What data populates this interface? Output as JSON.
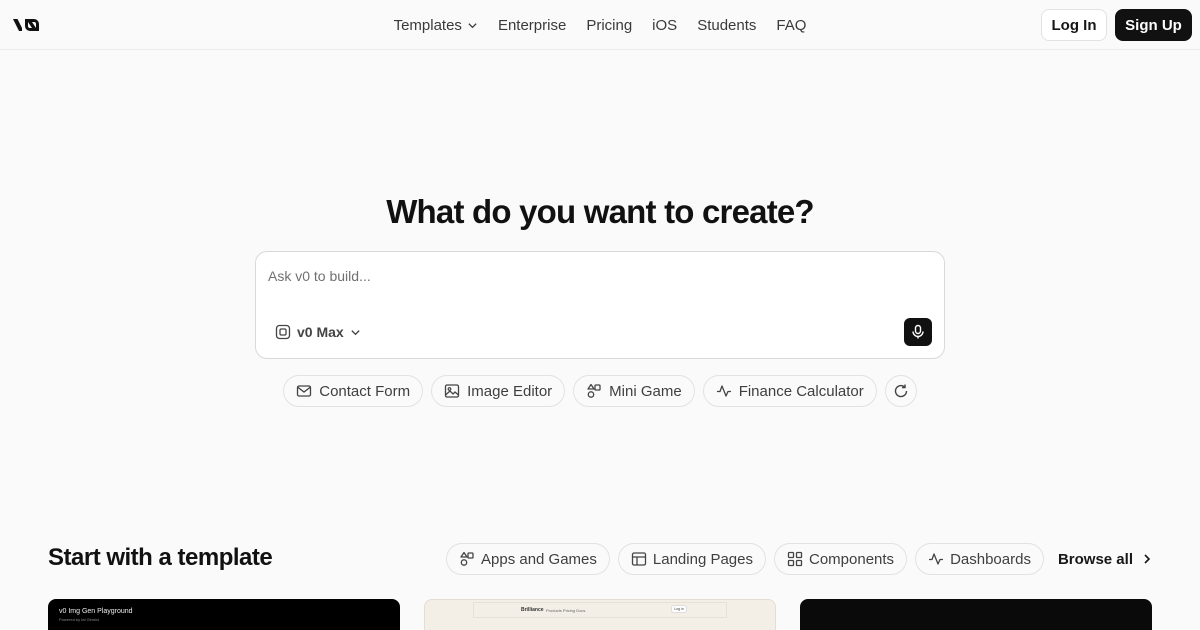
{
  "header": {
    "logo_text": "v0",
    "nav": [
      {
        "label": "Templates",
        "has_dropdown": true
      },
      {
        "label": "Enterprise"
      },
      {
        "label": "Pricing"
      },
      {
        "label": "iOS"
      },
      {
        "label": "Students"
      },
      {
        "label": "FAQ"
      }
    ],
    "login_label": "Log In",
    "signup_label": "Sign Up"
  },
  "hero": {
    "title": "What do you want to create?",
    "prompt": {
      "placeholder": "Ask v0 to build...",
      "value": "",
      "model_label": "v0 Max"
    },
    "suggestions": [
      {
        "label": "Contact Form",
        "icon": "mail-icon"
      },
      {
        "label": "Image Editor",
        "icon": "image-icon"
      },
      {
        "label": "Mini Game",
        "icon": "shapes-icon"
      },
      {
        "label": "Finance Calculator",
        "icon": "activity-icon"
      }
    ]
  },
  "templates": {
    "title": "Start with a template",
    "filters": [
      {
        "label": "Apps and Games",
        "icon": "shapes-icon"
      },
      {
        "label": "Landing Pages",
        "icon": "layout-icon"
      },
      {
        "label": "Components",
        "icon": "grid-icon"
      },
      {
        "label": "Dashboards",
        "icon": "activity-icon"
      }
    ],
    "browse_all_label": "Browse all",
    "cards": [
      {
        "title": "v0 Img Gen Playground",
        "subtitle": "Powered by fal Gemini"
      },
      {
        "brand": "Brilliance",
        "links": "Products  Pricing  Docs",
        "login": "Log in"
      },
      {}
    ]
  },
  "colors": {
    "background": "#fafafa",
    "primary": "#111111",
    "border": "#e2e2e2",
    "muted_text": "#707070"
  }
}
